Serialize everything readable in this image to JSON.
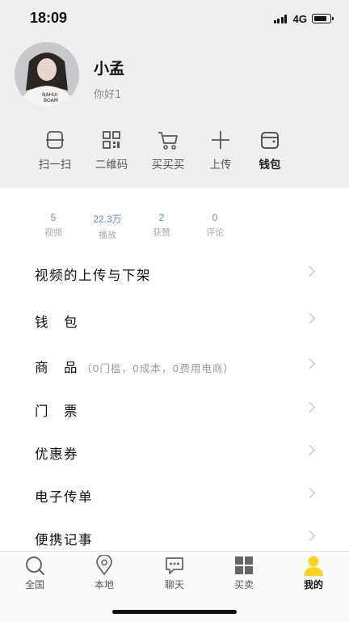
{
  "status_bar": {
    "time": "18:09",
    "network": "4G"
  },
  "profile": {
    "name": "小孟",
    "signature": "你好1",
    "shirt_text": "NAHUI\nBOAM"
  },
  "quick_actions": [
    {
      "label": "扫一扫",
      "icon": "scan-icon"
    },
    {
      "label": "二维码",
      "icon": "qrcode-icon"
    },
    {
      "label": "买买买",
      "icon": "cart-icon"
    },
    {
      "label": "上传",
      "icon": "plus-icon"
    },
    {
      "label": "钱包",
      "icon": "wallet-icon"
    }
  ],
  "stats": [
    {
      "value": "5",
      "label": "视频"
    },
    {
      "value": "22.3万",
      "label": "播放"
    },
    {
      "value": "2",
      "label": "获赞"
    },
    {
      "value": "0",
      "label": "评论"
    }
  ],
  "menu": [
    {
      "label": "视频的上传与下架",
      "sub": ""
    },
    {
      "label": "钱　包",
      "sub": ""
    },
    {
      "label": "商　品",
      "sub": "（0门槛，0成本，0费用电商）"
    },
    {
      "label": "门　票",
      "sub": ""
    },
    {
      "label": "优惠券",
      "sub": ""
    },
    {
      "label": "电子传单",
      "sub": ""
    },
    {
      "label": "便携记事",
      "sub": ""
    }
  ],
  "tabs": [
    {
      "label": "全国",
      "icon": "search-icon"
    },
    {
      "label": "本地",
      "icon": "location-pin-icon"
    },
    {
      "label": "聊天",
      "icon": "chat-bubble-icon"
    },
    {
      "label": "买卖",
      "icon": "grid-icon"
    },
    {
      "label": "我的",
      "icon": "user-icon",
      "active": true
    }
  ],
  "colors": {
    "accent_yellow": "#ffd21f",
    "stat_blue": "#5b8ad6",
    "header_bg": "#efefef"
  }
}
